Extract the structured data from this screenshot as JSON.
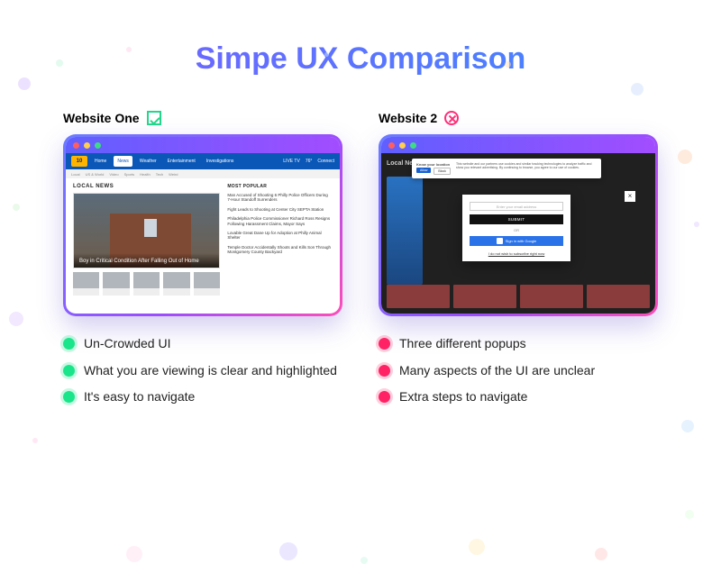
{
  "title": "Simpe UX Comparison",
  "left": {
    "heading": "Website One",
    "points": [
      "Un-Crowded UI",
      "What you are viewing is clear and highlighted",
      "It's easy to navigate"
    ],
    "screenshot": {
      "logo": "10",
      "nav": [
        "Home",
        "News",
        "Weather",
        "Entertainment",
        "Investigations"
      ],
      "nav_active_index": 1,
      "top_right": [
        "LIVE TV",
        "76°",
        "Connect"
      ],
      "subnav": [
        "Local",
        "US & World",
        "Video",
        "Sports",
        "Health",
        "Tech",
        "Weird"
      ],
      "section_label": "LOCAL NEWS",
      "hero_caption": "Boy in Critical Condition After Falling Out of Home",
      "sidebar_heading": "MOST POPULAR",
      "sidebar_items": [
        "Man Accused of Shooting 6 Philly Police Officers During 7-Hour Standoff Surrenders",
        "Fight Leads to Shooting at Center City SEPTA Station",
        "Philadelphia Police Commissioner Richard Ross Resigns Following Harassment Claims, Mayor Says",
        "Lovable Great Dane Up for Adoption at Philly Animal Shelter",
        "Temple Doctor Accidentally Shoots and Kills Son Through Montgomery County Backyard"
      ]
    }
  },
  "right": {
    "heading": "Website 2",
    "points": [
      "Three different popups",
      "Many aspects of the UI are unclear",
      "Extra steps to navigate"
    ],
    "screenshot": {
      "page_heading": "Local News",
      "cookie_prompt": "Know your location",
      "cookie_accept": "Allow",
      "cookie_decline": "Block",
      "cookie_text": "This website and our partners use cookies and similar tracking technologies to analyze traffic and show you relevant advertising. By continuing to browse, you agree to our use of cookies.",
      "newsletter_field_placeholder": "Enter your email address",
      "newsletter_submit": "SUBMIT",
      "newsletter_or": "OR",
      "newsletter_google": "Sign in with Google",
      "newsletter_skip": "I do not wish to subscribe right now",
      "close_label": "×"
    }
  }
}
